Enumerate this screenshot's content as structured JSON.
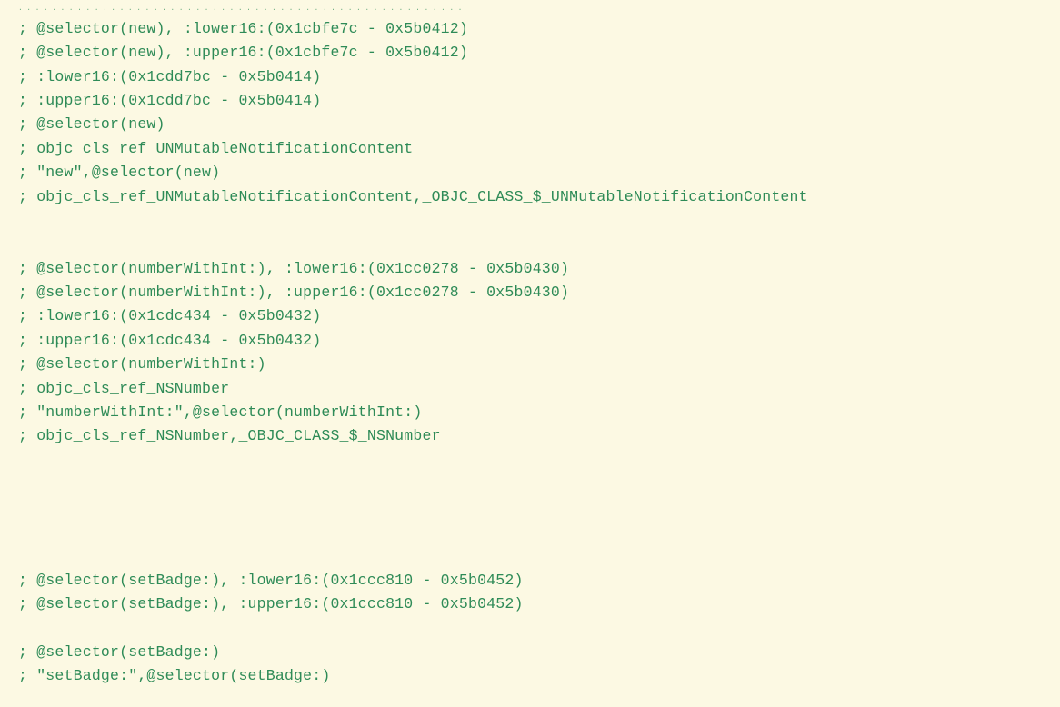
{
  "lines": [
    "; @selector(new), :lower16:(0x1cbfe7c - 0x5b0412)",
    "; @selector(new), :upper16:(0x1cbfe7c - 0x5b0412)",
    "; :lower16:(0x1cdd7bc - 0x5b0414)",
    "; :upper16:(0x1cdd7bc - 0x5b0414)",
    "; @selector(new)",
    "; objc_cls_ref_UNMutableNotificationContent",
    "; \"new\",@selector(new)",
    "; objc_cls_ref_UNMutableNotificationContent,_OBJC_CLASS_$_UNMutableNotificationContent",
    "",
    "",
    "; @selector(numberWithInt:), :lower16:(0x1cc0278 - 0x5b0430)",
    "; @selector(numberWithInt:), :upper16:(0x1cc0278 - 0x5b0430)",
    "; :lower16:(0x1cdc434 - 0x5b0432)",
    "; :upper16:(0x1cdc434 - 0x5b0432)",
    "; @selector(numberWithInt:)",
    "; objc_cls_ref_NSNumber",
    "; \"numberWithInt:\",@selector(numberWithInt:)",
    "; objc_cls_ref_NSNumber,_OBJC_CLASS_$_NSNumber",
    "",
    "",
    "",
    "",
    "",
    "; @selector(setBadge:), :lower16:(0x1ccc810 - 0x5b0452)",
    "; @selector(setBadge:), :upper16:(0x1ccc810 - 0x5b0452)",
    "",
    "; @selector(setBadge:)",
    "; \"setBadge:\",@selector(setBadge:)"
  ],
  "separator_dots": "....................................................."
}
